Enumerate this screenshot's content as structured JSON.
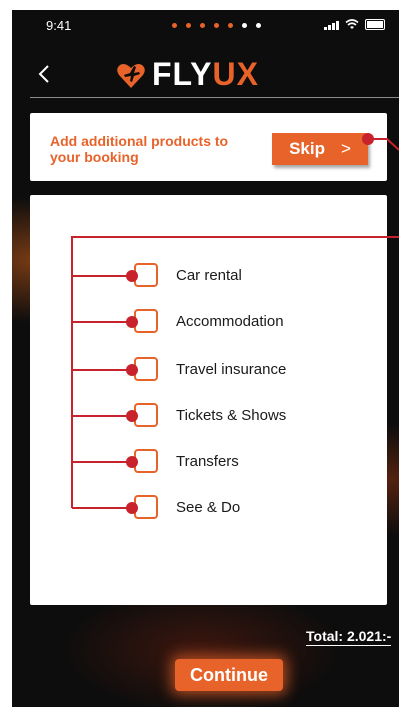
{
  "status_bar": {
    "time": "9:41"
  },
  "header": {
    "logo_part1": "FLY",
    "logo_part2": "UX"
  },
  "promo": {
    "text": "Add additional products to your booking",
    "skip_label": "Skip",
    "skip_chevron": ">"
  },
  "products": [
    {
      "label": "Car rental"
    },
    {
      "label": "Accommodation"
    },
    {
      "label": "Travel insurance"
    },
    {
      "label": "Tickets & Shows"
    },
    {
      "label": "Transfers"
    },
    {
      "label": "See & Do"
    }
  ],
  "footer": {
    "total": "Total: 2.021:-",
    "continue_label": "Continue"
  },
  "colors": {
    "accent": "#e8632a",
    "annotation": "#c8232c",
    "background": "#0d0d0d"
  },
  "icons": {
    "back": "chevron-left-icon",
    "logo": "plane-heart-icon",
    "signal": "signal-icon",
    "wifi": "wifi-icon",
    "battery": "battery-icon"
  }
}
